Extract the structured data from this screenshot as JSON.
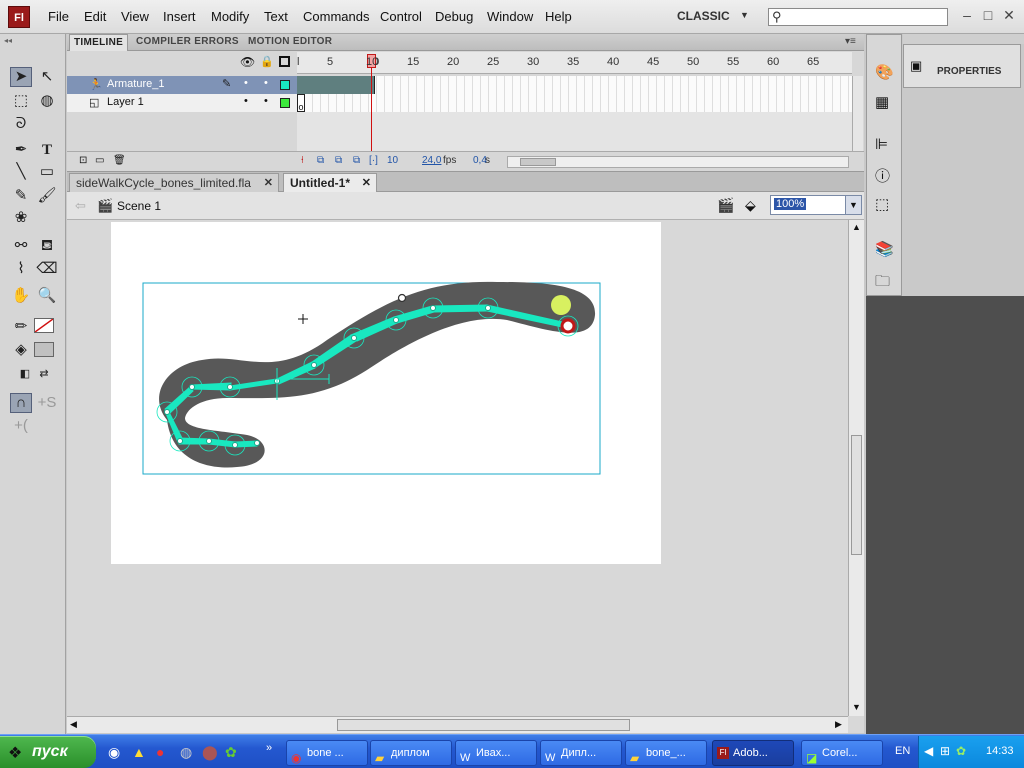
{
  "app": {
    "logo": "Fl",
    "workspace": "CLASSIC",
    "search_placeholder": ""
  },
  "menu": [
    "File",
    "Edit",
    "View",
    "Insert",
    "Modify",
    "Text",
    "Commands",
    "Control",
    "Debug",
    "Window",
    "Help"
  ],
  "window_controls": [
    "–",
    "□",
    "✕"
  ],
  "timeline": {
    "tabs": [
      "TIMELINE",
      "COMPILER ERRORS",
      "MOTION EDITOR"
    ],
    "active_tab": "TIMELINE",
    "frame_numbers": [
      "l",
      "5",
      "10",
      "15",
      "20",
      "25",
      "30",
      "35",
      "40",
      "45",
      "50",
      "55",
      "60",
      "65"
    ],
    "current_frame": "10",
    "layers": [
      {
        "name": "Armature_1",
        "selected": true
      },
      {
        "name": "Layer 1",
        "selected": false
      }
    ],
    "status": {
      "frame": "10",
      "fps": "24,0",
      "fps_unit": "fps",
      "time": "0,4",
      "time_unit": "s"
    }
  },
  "doc_tabs": [
    {
      "label": "sideWalkCycle_bones_limited.fla",
      "active": false
    },
    {
      "label": "Untitled-1*",
      "active": true
    }
  ],
  "edit_bar": {
    "scene": "Scene 1",
    "zoom": "100%"
  },
  "properties": {
    "label": "PROPERTIES"
  },
  "taskbar": {
    "start": "пуск",
    "tasks": [
      {
        "label": "bone ...",
        "active": false
      },
      {
        "label": "диплом",
        "active": false
      },
      {
        "label": "Ивах...",
        "active": false
      },
      {
        "label": "Дипл...",
        "active": false
      },
      {
        "label": "bone_...",
        "active": false
      },
      {
        "label": "Adob...",
        "active": true
      },
      {
        "label": "Corel...",
        "active": false
      }
    ],
    "lang": "EN",
    "clock": "14:33"
  },
  "colors": {
    "bone": "#18e8c0",
    "shape": "#555555",
    "selection": "#1aa8c8",
    "accent_red": "#c01818",
    "handle": "#d8f060"
  }
}
